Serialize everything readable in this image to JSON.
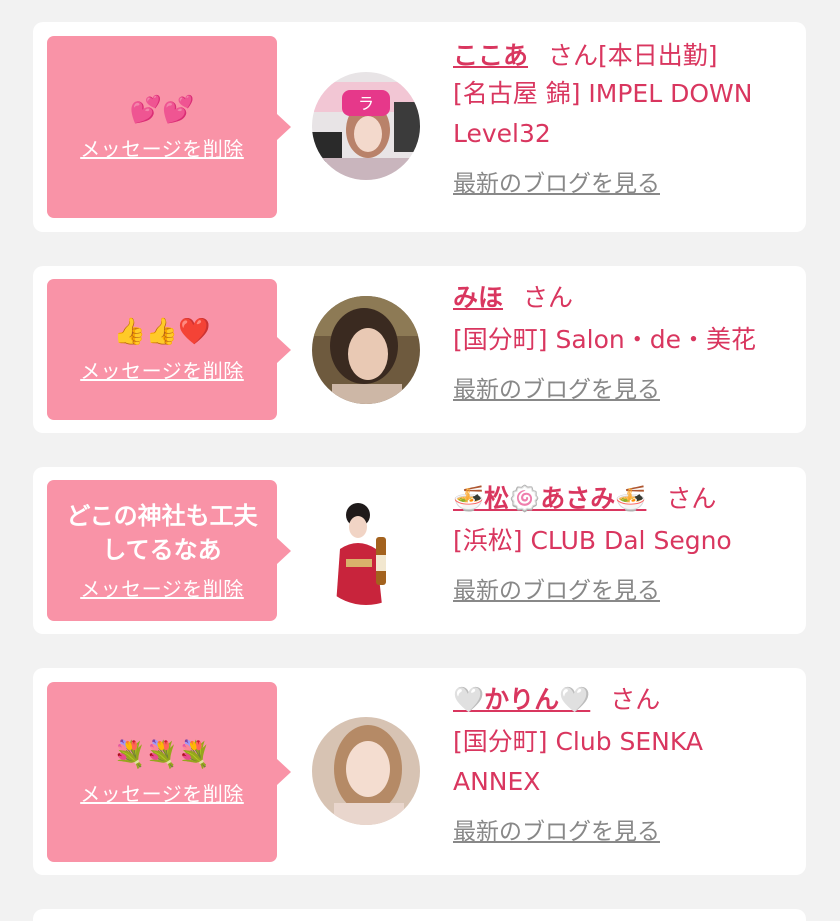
{
  "cards": [
    {
      "message": "💕💕",
      "message_is_emoji": true,
      "delete_label": "メッセージを削除",
      "name": "ここあ",
      "suffix": "さん",
      "status": "[本日出勤]",
      "shop": "[名古屋 錦] IMPEL DOWN Level32",
      "blog_label": "最新のブログを見る"
    },
    {
      "message": "👍👍❤️",
      "message_is_emoji": true,
      "delete_label": "メッセージを削除",
      "name": "みほ",
      "suffix": "さん",
      "status": "",
      "shop": "[国分町] Salon・de・美花",
      "blog_label": "最新のブログを見る"
    },
    {
      "message": "どこの神社も工夫してるなあ",
      "message_is_emoji": false,
      "delete_label": "メッセージを削除",
      "name": "🍜松🍥あさみ🍜",
      "suffix": "さん",
      "status": "",
      "shop": "[浜松] CLUB Dal Segno",
      "blog_label": "最新のブログを見る"
    },
    {
      "message": "💐💐💐",
      "message_is_emoji": true,
      "delete_label": "メッセージを削除",
      "name": "🤍かりん🤍",
      "suffix": "さん",
      "status": "",
      "shop": "[国分町] Club SENKA ANNEX",
      "blog_label": "最新のブログを見る"
    }
  ],
  "colors": {
    "accent": "#d9365f",
    "bubble": "#f993a7",
    "background": "#f2f2f2"
  }
}
